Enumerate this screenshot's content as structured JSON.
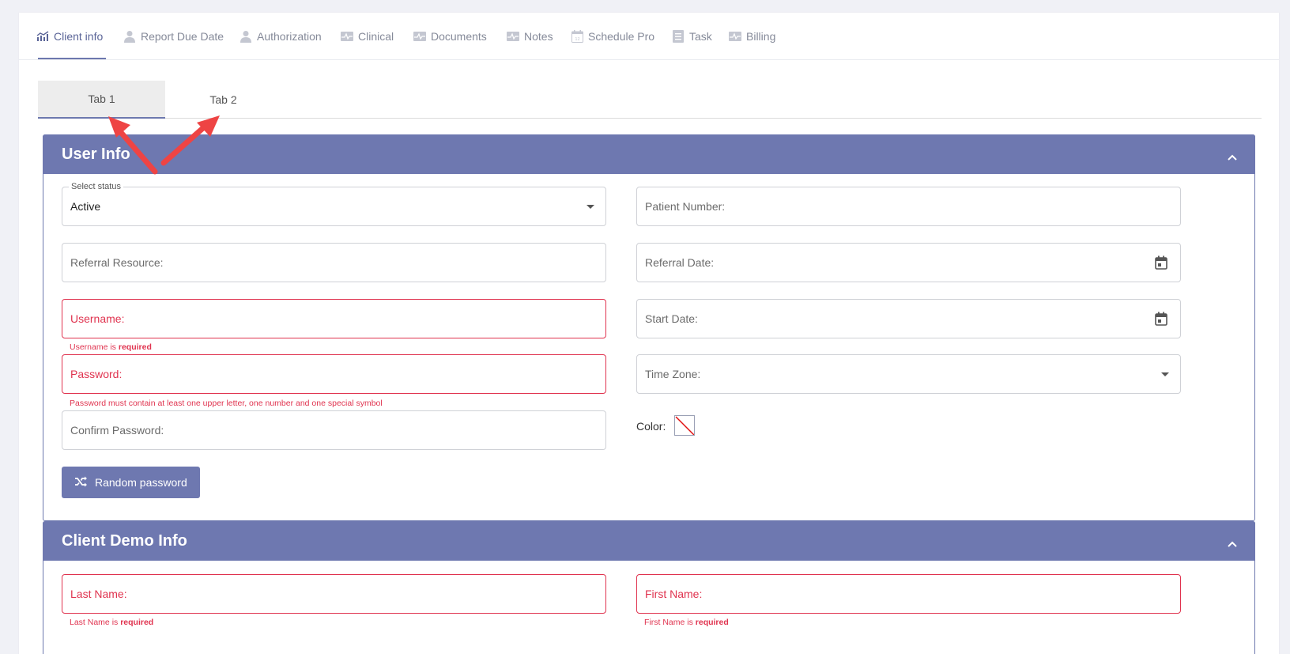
{
  "topnav": {
    "items": [
      {
        "label": "Client info",
        "icon": "chart-icon"
      },
      {
        "label": "Report Due Date",
        "icon": "user-icon"
      },
      {
        "label": "Authorization",
        "icon": "user-icon"
      },
      {
        "label": "Clinical",
        "icon": "pulse-icon"
      },
      {
        "label": "Documents",
        "icon": "pulse-icon"
      },
      {
        "label": "Notes",
        "icon": "pulse-icon"
      },
      {
        "label": "Schedule Pro",
        "icon": "calendar-icon"
      },
      {
        "label": "Task",
        "icon": "list-icon"
      },
      {
        "label": "Billing",
        "icon": "pulse-icon"
      }
    ],
    "active": "Client info"
  },
  "subtabs": [
    {
      "label": "Tab 1"
    },
    {
      "label": "Tab 2"
    }
  ],
  "user_info": {
    "title": "User Info",
    "status": {
      "label": "Select status",
      "value": "Active"
    },
    "patient_number": "Patient Number:",
    "referral_resource": "Referral Resource:",
    "referral_date": "Referral Date:",
    "username": "Username:",
    "username_hint": {
      "pre": "Username is ",
      "bold": "required"
    },
    "start_date": "Start Date:",
    "password": "Password:",
    "password_hint": "Password must contain at least one upper letter, one number and one special symbol",
    "time_zone": "Time Zone:",
    "confirm_password": "Confirm Password:",
    "color_label": "Color:",
    "random_password": "Random password"
  },
  "client_demo": {
    "title": "Client Demo Info",
    "last_name": "Last Name:",
    "last_name_hint": {
      "pre": "Last Name is ",
      "bold": "required"
    },
    "first_name": "First Name:",
    "first_name_hint": {
      "pre": "First Name is ",
      "bold": "required"
    }
  },
  "colors": {
    "accent": "#6e78b0",
    "error": "#e0334f",
    "annotation_arrow": "#ee4444"
  }
}
